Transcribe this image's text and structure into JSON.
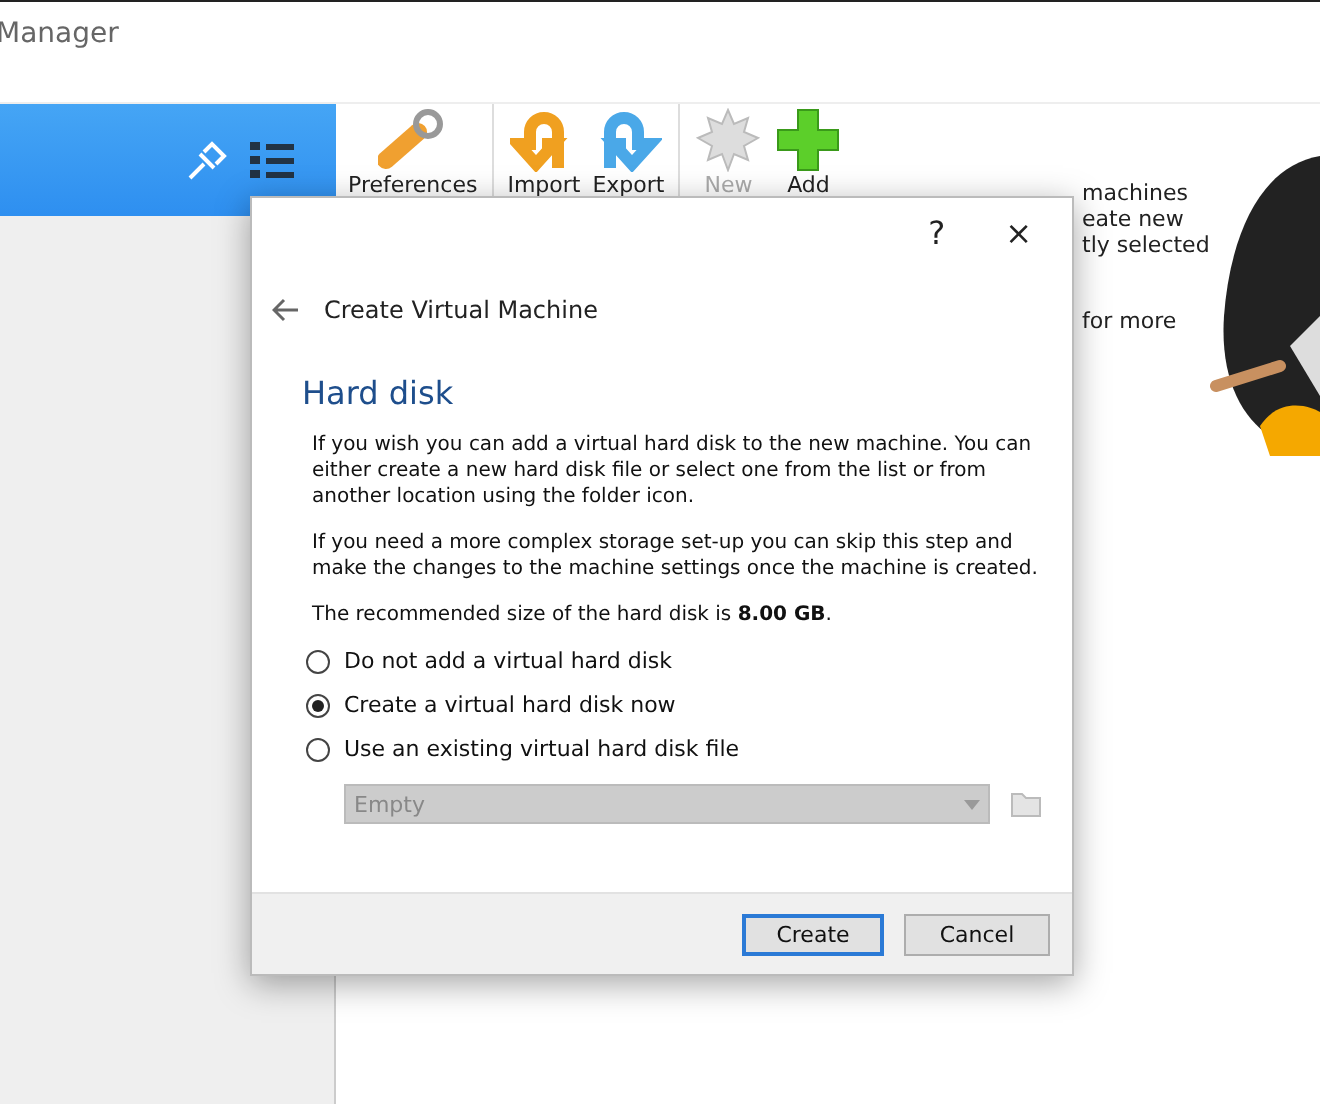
{
  "window": {
    "title": "Manager"
  },
  "sidebar": {
    "selected": true
  },
  "toolbar": [
    {
      "label": "Preferences",
      "kind": "wrench",
      "disabled": false
    },
    {
      "label": "Import",
      "kind": "import",
      "disabled": false
    },
    {
      "label": "Export",
      "kind": "export",
      "disabled": false
    },
    {
      "label": "New",
      "kind": "new",
      "disabled": true
    },
    {
      "label": "Add",
      "kind": "add",
      "disabled": false
    }
  ],
  "welcome_fragments": [
    "machines",
    "eate new",
    "tly selected",
    "for more"
  ],
  "dialog": {
    "help": "?",
    "close": "×",
    "back_title": "Create Virtual Machine",
    "heading": "Hard disk",
    "paragraphs": [
      "If you wish you can add a virtual hard disk to the new machine. You can either create a new hard disk file or select one from the list or from another location using the folder icon.",
      "If you need a more complex storage set-up you can skip this step and make the changes to the machine settings once the machine is created.",
      "The recommended size of the hard disk is **8.00 GB**."
    ],
    "options": [
      {
        "label": "Do not add a virtual hard disk",
        "selected": false
      },
      {
        "label": "Create a virtual hard disk now",
        "selected": true
      },
      {
        "label": "Use an existing virtual hard disk file",
        "selected": false
      }
    ],
    "file_select": {
      "value": "Empty",
      "disabled": true
    },
    "buttons": [
      {
        "label": "Create",
        "default": true
      },
      {
        "label": "Cancel",
        "default": false
      }
    ]
  }
}
